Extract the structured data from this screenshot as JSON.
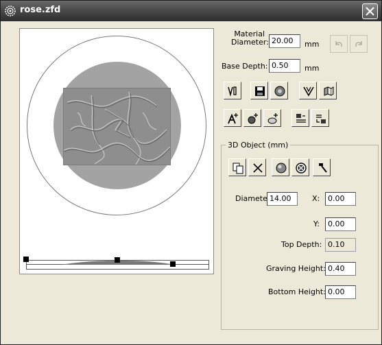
{
  "window": {
    "title": "rose.zfd"
  },
  "material": {
    "label_line1": "Material",
    "label_line2": "Diameter:",
    "value": "20.00",
    "unit": "mm"
  },
  "base_depth": {
    "label": "Base Depth:",
    "value": "0.50",
    "unit": "mm"
  },
  "group": {
    "title": "3D Object (mm)"
  },
  "object": {
    "diameter_label": "Diameter:",
    "diameter_value": "14.00",
    "x_label": "X:",
    "x_value": "0.00",
    "y_label": "Y:",
    "y_value": "0.00",
    "top_depth_label": "Top Depth:",
    "top_depth_value": "0.10",
    "graving_height_label": "Graving Height:",
    "graving_height_value": "0.40",
    "bottom_height_label": "Bottom Height:",
    "bottom_height_value": "0.00"
  },
  "icons": {
    "title": "gear-icon",
    "toolbar_row1": [
      "import-vector-icon",
      "save-icon",
      "disc-icon",
      "v-carve-icon",
      "map-icon"
    ],
    "toolbar_row2": [
      "add-text-icon",
      "add-object-icon",
      "add-shape-icon",
      "text-to-image-icon",
      "image-to-text-icon"
    ],
    "group_toolbar": [
      "copy-icon",
      "delete-icon",
      "sphere-icon",
      "target-icon",
      "hammer-icon"
    ],
    "undo_redo": [
      "undo-icon",
      "redo-icon"
    ]
  },
  "colors": {
    "titlebar": "#3f3f3f",
    "window_bg": "#ece9d8",
    "disc": "#a3a3a3"
  }
}
